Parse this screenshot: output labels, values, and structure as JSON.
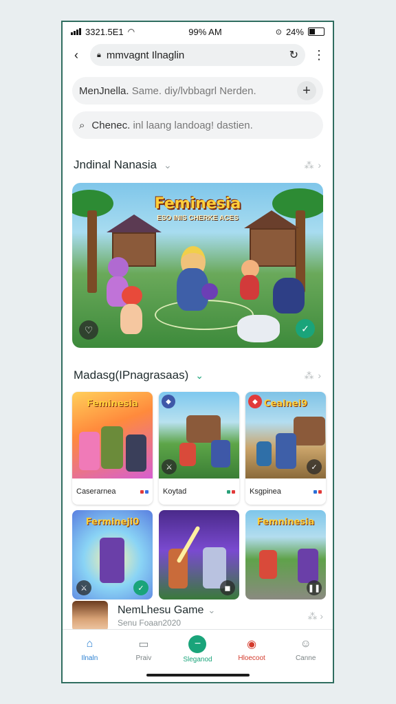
{
  "status": {
    "signal_text": "3321.5E1",
    "time": "99% AM",
    "battery": "24%"
  },
  "browser": {
    "url": "mmvagnt Ilnaglin",
    "back_icon": "chevron-left-icon",
    "reload_icon": "reload-icon",
    "menu_icon": "kebab-menu-icon"
  },
  "note_field": {
    "label": "MenJnella.",
    "value": "Same. diy/lvbbagrl Nerden."
  },
  "search": {
    "query": "Chenec.",
    "rest": "inl laang landoag! dastien."
  },
  "sections": {
    "featured": {
      "title": "Jndinal Nanasia"
    },
    "grid": {
      "title": "Madasg(IPnagrasaas)"
    }
  },
  "hero": {
    "title": "Feminesia",
    "subtitle": "ESO INIS CHERKE ACES"
  },
  "cards": [
    {
      "title": "Feminesia",
      "label": "Caserarnea",
      "colors": [
        "#e13a3a",
        "#3a6ee1"
      ]
    },
    {
      "title": "",
      "label": "Koytad",
      "colors": [
        "#2aa07a",
        "#e13a3a"
      ]
    },
    {
      "title": "Cealnei9",
      "label": "Ksgpinea",
      "colors": [
        "#2a6fd8",
        "#e13a3a"
      ]
    }
  ],
  "tiles": [
    {
      "title": "Fermineji0"
    },
    {
      "title": ""
    },
    {
      "title": "Femninesia"
    }
  ],
  "list_item": {
    "title": "NemLhesu Game",
    "subtitle": "Senu Foaan2020"
  },
  "tabs": [
    {
      "label": "Ilnaln",
      "icon": "home-icon"
    },
    {
      "label": "Praiv",
      "icon": "tablet-icon"
    },
    {
      "label": "Sleganod",
      "icon": "minus-circle-icon"
    },
    {
      "label": "Hloecoot",
      "icon": "record-icon"
    },
    {
      "label": "Canne",
      "icon": "person-icon"
    }
  ],
  "colors": {
    "accent_green": "#1aa47a",
    "accent_blue": "#2a7fd1",
    "accent_red": "#d33a2c"
  }
}
